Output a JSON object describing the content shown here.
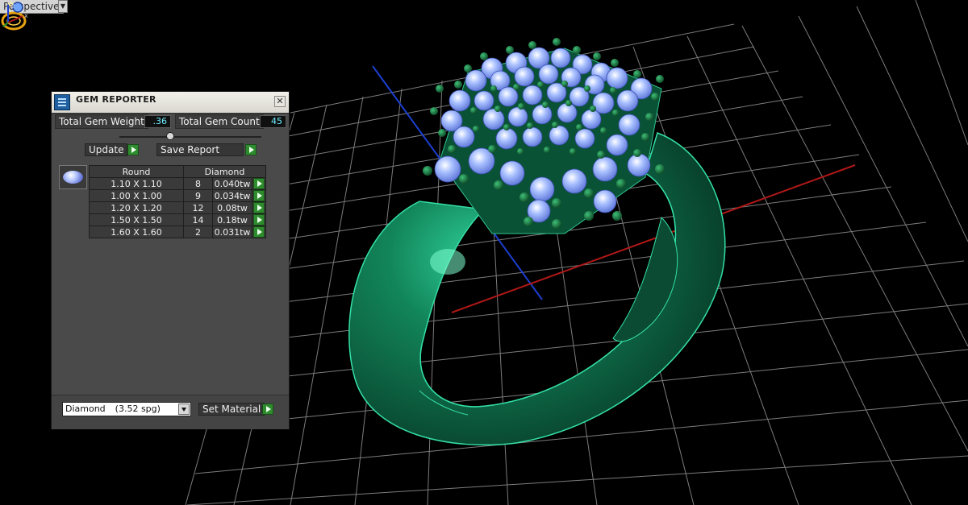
{
  "viewport": {
    "label": "Perspective"
  },
  "panel": {
    "title": "GEM REPORTER",
    "total_gem_weight_label": "Total Gem Weight",
    "total_gem_weight_value": ".36",
    "total_gem_count_label": "Total Gem Count",
    "total_gem_count_value": "45",
    "update_label": "Update",
    "save_report_label": "Save Report",
    "table": {
      "headers": [
        "Round",
        "Diamond"
      ],
      "rows": [
        {
          "size": "1.10 X 1.10",
          "count": "8",
          "weight": "0.040tw"
        },
        {
          "size": "1.00 X 1.00",
          "count": "9",
          "weight": "0.034tw"
        },
        {
          "size": "1.20 X 1.20",
          "count": "12",
          "weight": "0.08tw"
        },
        {
          "size": "1.50 X 1.50",
          "count": "14",
          "weight": "0.18tw"
        },
        {
          "size": "1.60 X 1.60",
          "count": "2",
          "weight": "0.031tw"
        }
      ]
    },
    "material_select": {
      "name": "Diamond",
      "density": "(3.52 spg)"
    },
    "set_material_label": "Set Material"
  },
  "colors": {
    "ring": "#0f6b49",
    "ring_highlight": "#2fd09a",
    "prong": "#1e6e3a",
    "gem": "#9fb8ff",
    "grid": "#8a8a8a",
    "axis_x": "#b01818",
    "axis_y": "#1c3fd0",
    "value_text": "#6cf0ff",
    "go_button": "#2e8b2e"
  },
  "icons": {
    "brand": "ring-logo-icon",
    "gizmo": "xyz-axis-icon",
    "title": "gem-reporter-icon"
  }
}
